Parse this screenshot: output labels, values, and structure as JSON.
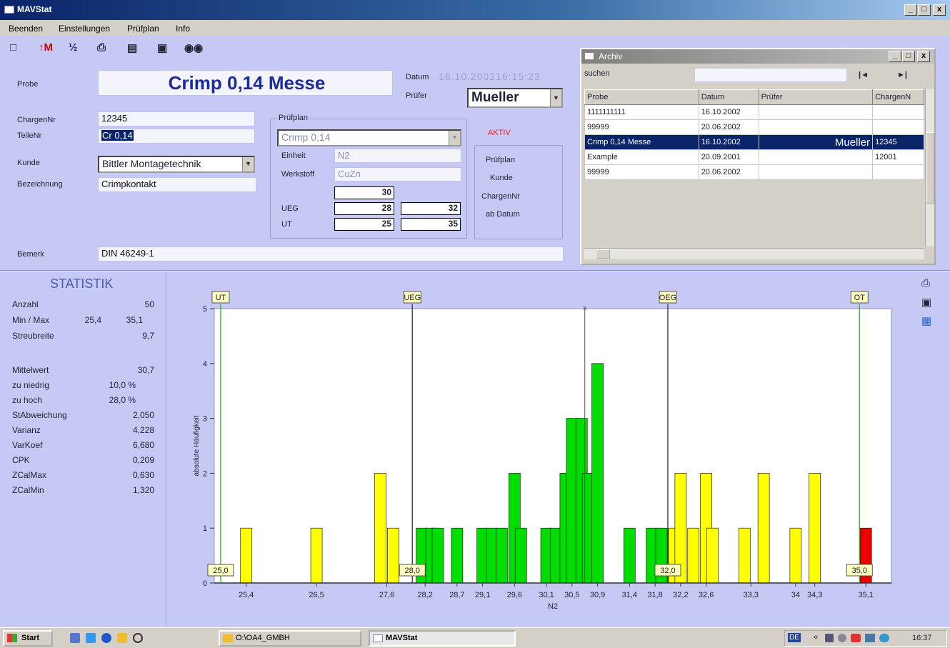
{
  "window": {
    "title": "MAVStat",
    "controls": [
      "_",
      "□",
      "x"
    ]
  },
  "menu": [
    "Beenden",
    "Einstellungen",
    "Prüfplan",
    "Info"
  ],
  "form": {
    "probe_label": "Probe",
    "probe_value": "Crimp 0,14 Messe",
    "datum_label": "Datum",
    "datum_value": "16.10.200216:15:23",
    "pruefer_label": "Prüfer",
    "pruefer_value": "Mueller",
    "chargennr_label": "ChargenNr",
    "chargennr_value": "12345",
    "teilenr_label": "TeileNr",
    "teilenr_value": "Cr 0,14",
    "kunde_label": "Kunde",
    "kunde_value": "Bittler Montagetechnik",
    "bezeichnung_label": "Bezeichnung",
    "bezeichnung_value": "Crimpkontakt",
    "bemerk_label": "Bemerk",
    "bemerk_value": "DIN 46249-1"
  },
  "pruefplan": {
    "label": "Prüfplan",
    "value": "Crimp 0,14",
    "einheit_label": "Einheit",
    "einheit_value": "N2",
    "werkstoff_label": "Werkstoff",
    "werkstoff_value": "CuZn",
    "nominal": "30",
    "ueg_label": "UEG",
    "ueg_value": "28",
    "oeg_value": "32",
    "ut_label": "UT",
    "ut_value": "25",
    "ot_value": "35"
  },
  "filter": {
    "status": "AKTIV",
    "items": [
      "Prüfplan",
      "Kunde",
      "ChargenNr",
      "ab Datum"
    ]
  },
  "archiv": {
    "title": "Archiv",
    "search_label": "suchen",
    "search_value": "",
    "nav_first": "|◄",
    "nav_last": "►|",
    "columns": [
      "Probe",
      "Datum",
      "Prüfer",
      "ChargenN"
    ],
    "rows": [
      [
        "1111111111",
        "16.10.2002",
        "",
        ""
      ],
      [
        "99999",
        "20.06.2002",
        "",
        ""
      ],
      [
        "Crimp 0,14 Messe",
        "16.10.2002",
        "Mueller",
        "12345"
      ],
      [
        "Example",
        "20.09.2001",
        "",
        "12001"
      ],
      [
        "99999",
        "20.06.2002",
        "",
        ""
      ]
    ],
    "selected_row": 2
  },
  "statistik": {
    "title": "STATISTIK",
    "anzahl_label": "Anzahl",
    "anzahl": "50",
    "minmax_label": "Min / Max",
    "min": "25,4",
    "max": "35,1",
    "streubreite_label": "Streubreite",
    "streubreite": "9,7",
    "mittelwert_label": "Mittelwert",
    "mittelwert": "30,7",
    "zu_niedrig_label": "zu niedrig",
    "zu_niedrig": "10,0 %",
    "zu_hoch_label": "zu hoch",
    "zu_hoch": "28,0 %",
    "stabw_label": "StAbweichung",
    "stabw": "2,050",
    "varianz_label": "Varianz",
    "varianz": "4,228",
    "varkoef_label": "VarKoef",
    "varkoef": "6,680",
    "cpk_label": "CPK",
    "cpk": "0,209",
    "zcalmax_label": "ZCalMax",
    "zcalmax": "0,630",
    "zcalmin_label": "ZCalMin",
    "zcalmin": "1,320"
  },
  "chart_data": {
    "type": "bar",
    "xlabel": "N2",
    "ylabel": "absolute Häufigkeit",
    "xlim": [
      24.9,
      35.5
    ],
    "ylim": [
      0,
      5
    ],
    "yticks": [
      0,
      1,
      2,
      3,
      4,
      5
    ],
    "xtick_labels": [
      "25,4",
      "26,5",
      "27,6",
      "28,2",
      "28,7",
      "29,1",
      "29,6",
      "30,1",
      "30,5",
      "30,9",
      "31,4",
      "31,8",
      "32,2",
      "32,6",
      "33,3",
      "34",
      "34,3",
      "35,1"
    ],
    "xtick_values": [
      25.4,
      26.5,
      27.6,
      28.2,
      28.7,
      29.1,
      29.6,
      30.1,
      30.5,
      30.9,
      31.4,
      31.8,
      32.2,
      32.6,
      33.3,
      34.0,
      34.3,
      35.1
    ],
    "limits": [
      {
        "name": "UT",
        "value": 25.0,
        "label": "25,0",
        "color": "#33aa33"
      },
      {
        "name": "UEG",
        "value": 28.0,
        "label": "28,0",
        "color": "#333333"
      },
      {
        "name": "OEG",
        "value": 32.0,
        "label": "32,0",
        "color": "#333333"
      },
      {
        "name": "OT",
        "value": 35.0,
        "label": "35,0",
        "color": "#33aa33"
      }
    ],
    "mean": 30.7,
    "mean_marker": "x",
    "bars": [
      {
        "x": 25.4,
        "count": 1,
        "color": "yellow"
      },
      {
        "x": 26.5,
        "count": 1,
        "color": "yellow"
      },
      {
        "x": 27.5,
        "count": 2,
        "color": "yellow"
      },
      {
        "x": 27.7,
        "count": 1,
        "color": "yellow"
      },
      {
        "x": 28.15,
        "count": 1,
        "color": "green"
      },
      {
        "x": 28.3,
        "count": 1,
        "color": "green"
      },
      {
        "x": 28.4,
        "count": 1,
        "color": "green"
      },
      {
        "x": 28.7,
        "count": 1,
        "color": "green"
      },
      {
        "x": 29.1,
        "count": 1,
        "color": "green"
      },
      {
        "x": 29.25,
        "count": 1,
        "color": "green"
      },
      {
        "x": 29.4,
        "count": 1,
        "color": "green"
      },
      {
        "x": 29.6,
        "count": 2,
        "color": "green"
      },
      {
        "x": 29.7,
        "count": 1,
        "color": "green"
      },
      {
        "x": 30.1,
        "count": 1,
        "color": "green"
      },
      {
        "x": 30.25,
        "count": 1,
        "color": "green"
      },
      {
        "x": 30.4,
        "count": 2,
        "color": "green"
      },
      {
        "x": 30.5,
        "count": 3,
        "color": "green"
      },
      {
        "x": 30.65,
        "count": 3,
        "color": "green"
      },
      {
        "x": 30.75,
        "count": 2,
        "color": "green"
      },
      {
        "x": 30.9,
        "count": 4,
        "color": "green"
      },
      {
        "x": 31.4,
        "count": 1,
        "color": "green"
      },
      {
        "x": 31.75,
        "count": 1,
        "color": "green"
      },
      {
        "x": 31.9,
        "count": 1,
        "color": "green"
      },
      {
        "x": 32.1,
        "count": 1,
        "color": "yellow"
      },
      {
        "x": 32.2,
        "count": 2,
        "color": "yellow"
      },
      {
        "x": 32.4,
        "count": 1,
        "color": "yellow"
      },
      {
        "x": 32.6,
        "count": 2,
        "color": "yellow"
      },
      {
        "x": 32.7,
        "count": 1,
        "color": "yellow"
      },
      {
        "x": 33.2,
        "count": 1,
        "color": "yellow"
      },
      {
        "x": 33.5,
        "count": 2,
        "color": "yellow"
      },
      {
        "x": 34.0,
        "count": 1,
        "color": "yellow"
      },
      {
        "x": 34.3,
        "count": 2,
        "color": "yellow"
      },
      {
        "x": 35.1,
        "count": 1,
        "color": "red"
      }
    ],
    "colors": {
      "yellow": "#ffff00",
      "green": "#00dd00",
      "red": "#ee0000"
    }
  },
  "taskbar": {
    "start": "Start",
    "folder_task": "O:\\OA4_GMBH",
    "app_task": "MAVStat",
    "clock": "16:37",
    "lang": "DE"
  }
}
